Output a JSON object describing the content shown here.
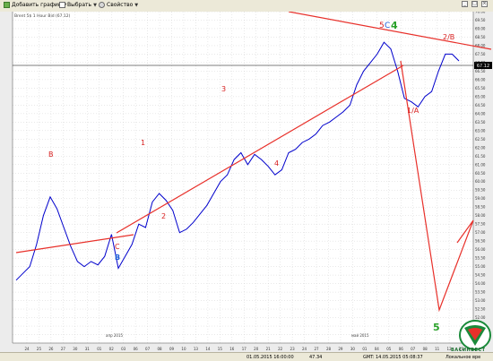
{
  "toolbar": {
    "add_chart_label": "Добавить график",
    "select_label": "Выбрать",
    "properties_label": "Свойство"
  },
  "chart": {
    "title_line": "Brent 5$ 1 Hour Bid (67.12)",
    "price_badge": "67.12",
    "month_apr": "апр 2015",
    "month_may": "май 2015"
  },
  "status": {
    "datetime_left": "01.05.2015 16:00:00",
    "value": "47.34",
    "gmt": "GMT: 14.05.2015 05:08:37",
    "local_label": "Локальное вре"
  },
  "logo": {
    "name": "ВАСИНВЕСТ"
  },
  "colors": {
    "price_line": "#0000cc",
    "trend_lines": "#e8302a",
    "wave_green": "#2aa12a",
    "wave_blue": "#1a5ad8",
    "wave_red": "#d82020",
    "background": "#ffffff",
    "grid": "#c8c8c8"
  },
  "chart_data": {
    "type": "line",
    "x_tick_labels": [
      "24",
      "25",
      "26",
      "27",
      "30",
      "31",
      "01",
      "02",
      "03",
      "06",
      "07",
      "08",
      "09",
      "10",
      "13",
      "14",
      "15",
      "16",
      "17",
      "20",
      "21",
      "22",
      "23",
      "24",
      "27",
      "28",
      "29",
      "30",
      "01",
      "04",
      "05",
      "06",
      "07",
      "08",
      "11",
      "12",
      "13",
      "14"
    ],
    "y_tick_labels": [
      "70.00",
      "69.50",
      "69.00",
      "68.50",
      "68.00",
      "67.50",
      "67.00",
      "66.50",
      "66.00",
      "65.50",
      "65.00",
      "64.50",
      "64.00",
      "63.50",
      "63.00",
      "62.50",
      "62.00",
      "61.50",
      "61.00",
      "60.50",
      "60.00",
      "59.50",
      "59.00",
      "58.50",
      "58.00",
      "57.50",
      "57.00",
      "56.50",
      "56.00",
      "55.50",
      "55.00",
      "54.50",
      "54.00",
      "53.50",
      "53.00",
      "52.50",
      "52.00",
      "51.50",
      "51.00",
      "50.50"
    ],
    "ylim": [
      50.5,
      70.0
    ],
    "wave_labels": [
      {
        "text": "B",
        "color": "red"
      },
      {
        "text": "C",
        "color": "red"
      },
      {
        "text": "B",
        "color": "blue"
      },
      {
        "text": "1",
        "color": "red"
      },
      {
        "text": "2",
        "color": "red"
      },
      {
        "text": "3",
        "color": "red"
      },
      {
        "text": "4",
        "color": "red"
      },
      {
        "text": "5",
        "color": "red"
      },
      {
        "text": "C",
        "color": "blue"
      },
      {
        "text": "4",
        "color": "green"
      },
      {
        "text": "1/A",
        "color": "red"
      },
      {
        "text": "2/B",
        "color": "red"
      },
      {
        "text": "5",
        "color": "green"
      }
    ],
    "series": [
      {
        "values": [
          54.2,
          54.6,
          55.0,
          56.3,
          58.0,
          59.1,
          58.4,
          57.3,
          56.2,
          55.3,
          55.0,
          55.3,
          55.1,
          55.6,
          56.9,
          54.9,
          55.6,
          56.3,
          57.5,
          57.3,
          58.8,
          59.3,
          58.9,
          58.3,
          57.0,
          57.2,
          57.6,
          58.1,
          58.6,
          59.3,
          60.0,
          60.4,
          61.3,
          61.7,
          61.0,
          61.6,
          61.3,
          60.9,
          60.4,
          60.7,
          61.7,
          61.9,
          62.3,
          62.5,
          62.8,
          63.3,
          63.5,
          63.8,
          64.1,
          64.5,
          65.7,
          66.5,
          67.0,
          67.5,
          68.2,
          67.8,
          66.5,
          64.9,
          64.7,
          64.4,
          65.0,
          65.3,
          66.5,
          67.5,
          67.5,
          67.1
        ]
      }
    ],
    "grid": true
  }
}
